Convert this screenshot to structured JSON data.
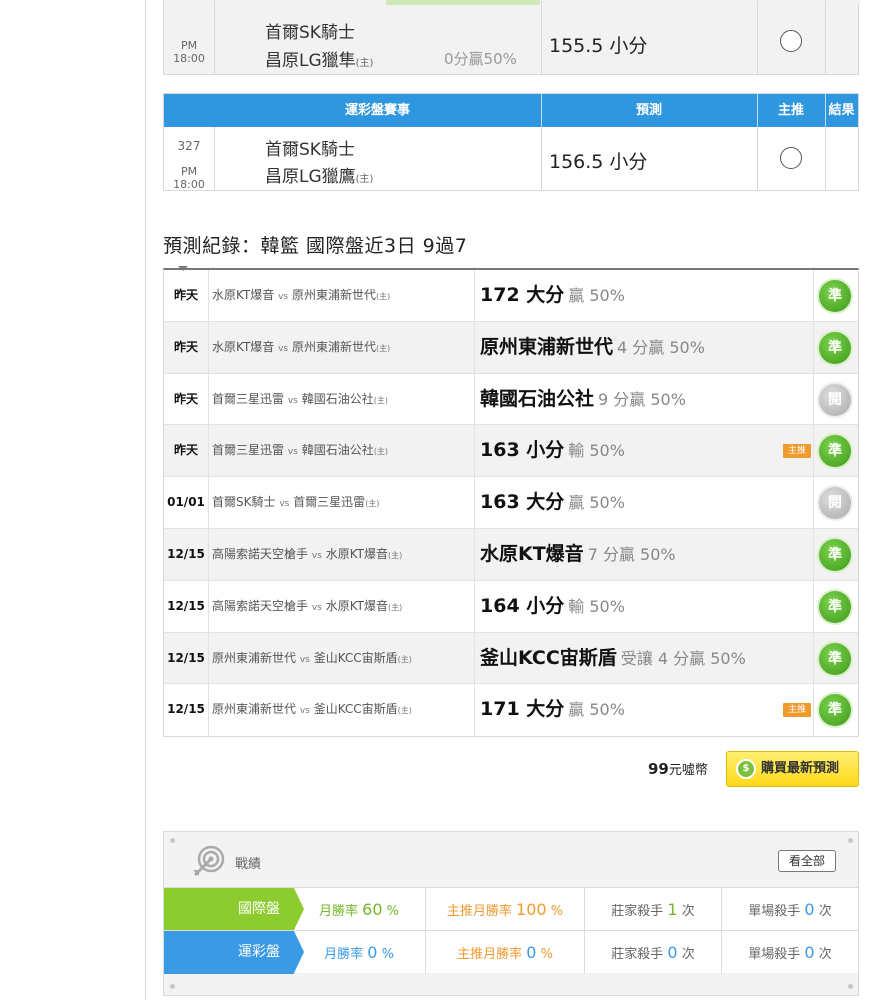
{
  "top_card": {
    "time": "PM 18:00",
    "home": "首爾SK騎士",
    "away": "昌原LG獵隼",
    "host_mark": "(主)",
    "handicap": "0分贏50%",
    "prediction": "155.5 小分"
  },
  "lottery": {
    "headers": [
      "運彩盤賽事",
      "預測",
      "主推",
      "結果"
    ],
    "row": {
      "num": "327",
      "time": "PM 18:00",
      "home": "首爾SK騎士",
      "away": "昌原LG獵鷹",
      "host_mark": "(主)",
      "prediction": "156.5 小分"
    }
  },
  "record_heading": "預測紀錄：韓籃 國際盤近3日 9過7",
  "records": [
    {
      "date": "昨天",
      "team1": "水原KT爆音",
      "vs": "vs",
      "team2": "原州東浦新世代",
      "host": "(主)",
      "pick": "172 大分",
      "sub": "贏 50%",
      "main_badge": "",
      "result": "準",
      "result_type": "win"
    },
    {
      "date": "昨天",
      "team1": "水原KT爆音",
      "vs": "vs",
      "team2": "原州東浦新世代",
      "host": "(主)",
      "pick": "原州東浦新世代",
      "sub": "4 分贏 50%",
      "main_badge": "",
      "result": "準",
      "result_type": "win"
    },
    {
      "date": "昨天",
      "team1": "首爾三星迅雷",
      "vs": "vs",
      "team2": "韓國石油公社",
      "host": "(主)",
      "pick": "韓國石油公社",
      "sub": "9 分贏 50%",
      "main_badge": "",
      "result": "閱",
      "result_type": "push"
    },
    {
      "date": "昨天",
      "team1": "首爾三星迅雷",
      "vs": "vs",
      "team2": "韓國石油公社",
      "host": "(主)",
      "pick": "163 小分",
      "sub": "輸 50%",
      "main_badge": "主推",
      "result": "準",
      "result_type": "win"
    },
    {
      "date": "01/01",
      "team1": "首爾SK騎士",
      "vs": "vs",
      "team2": "首爾三星迅雷",
      "host": "(主)",
      "pick": "163 大分",
      "sub": "贏 50%",
      "main_badge": "",
      "result": "閱",
      "result_type": "push"
    },
    {
      "date": "12/15",
      "team1": "高陽索諾天空槍手",
      "vs": "vs",
      "team2": "水原KT爆音",
      "host": "(主)",
      "pick": "水原KT爆音",
      "sub": "7 分贏 50%",
      "main_badge": "",
      "result": "準",
      "result_type": "win"
    },
    {
      "date": "12/15",
      "team1": "高陽索諾天空槍手",
      "vs": "vs",
      "team2": "水原KT爆音",
      "host": "(主)",
      "pick": "164 小分",
      "sub": "輸 50%",
      "main_badge": "",
      "result": "準",
      "result_type": "win"
    },
    {
      "date": "12/15",
      "team1": "原州東浦新世代",
      "vs": "vs",
      "team2": "釜山KCC宙斯盾",
      "host": "(主)",
      "pick": "釜山KCC宙斯盾",
      "sub": "受讓 4 分贏 50%",
      "main_badge": "",
      "result": "準",
      "result_type": "win"
    },
    {
      "date": "12/15",
      "team1": "原州東浦新世代",
      "vs": "vs",
      "team2": "釜山KCC宙斯盾",
      "host": "(主)",
      "pick": "171 大分",
      "sub": "贏 50%",
      "main_badge": "主推",
      "result": "準",
      "result_type": "win"
    }
  ],
  "buy": {
    "price_num": "99",
    "price_unit": "元噓幣",
    "button_label": "購買最新預測",
    "button_icon": "coin-icon"
  },
  "stats": {
    "title": "戰績",
    "view_all": "看全部",
    "rows": [
      {
        "label": "國際盤",
        "monthly_label": "月勝率",
        "monthly_val": "60",
        "main_label": "主推月勝率",
        "main_val": "100",
        "banker_label": "莊家殺手",
        "banker_val": "1",
        "single_label": "單場殺手",
        "single_val": "0",
        "unit_pct": "%",
        "unit_times": "次"
      },
      {
        "label": "運彩盤",
        "monthly_label": "月勝率",
        "monthly_val": "0",
        "main_label": "主推月勝率",
        "main_val": "0",
        "banker_label": "莊家殺手",
        "banker_val": "0",
        "single_label": "單場殺手",
        "single_val": "0",
        "unit_pct": "%",
        "unit_times": "次"
      }
    ]
  },
  "colors": {
    "header_blue": "#2f96e0",
    "win_green": "#4fae22",
    "badge_orange": "#ef9a2e",
    "buy_yellow": "#ffd91a",
    "intl_green": "#8ccc2f",
    "lot_blue": "#3b9ae6"
  }
}
